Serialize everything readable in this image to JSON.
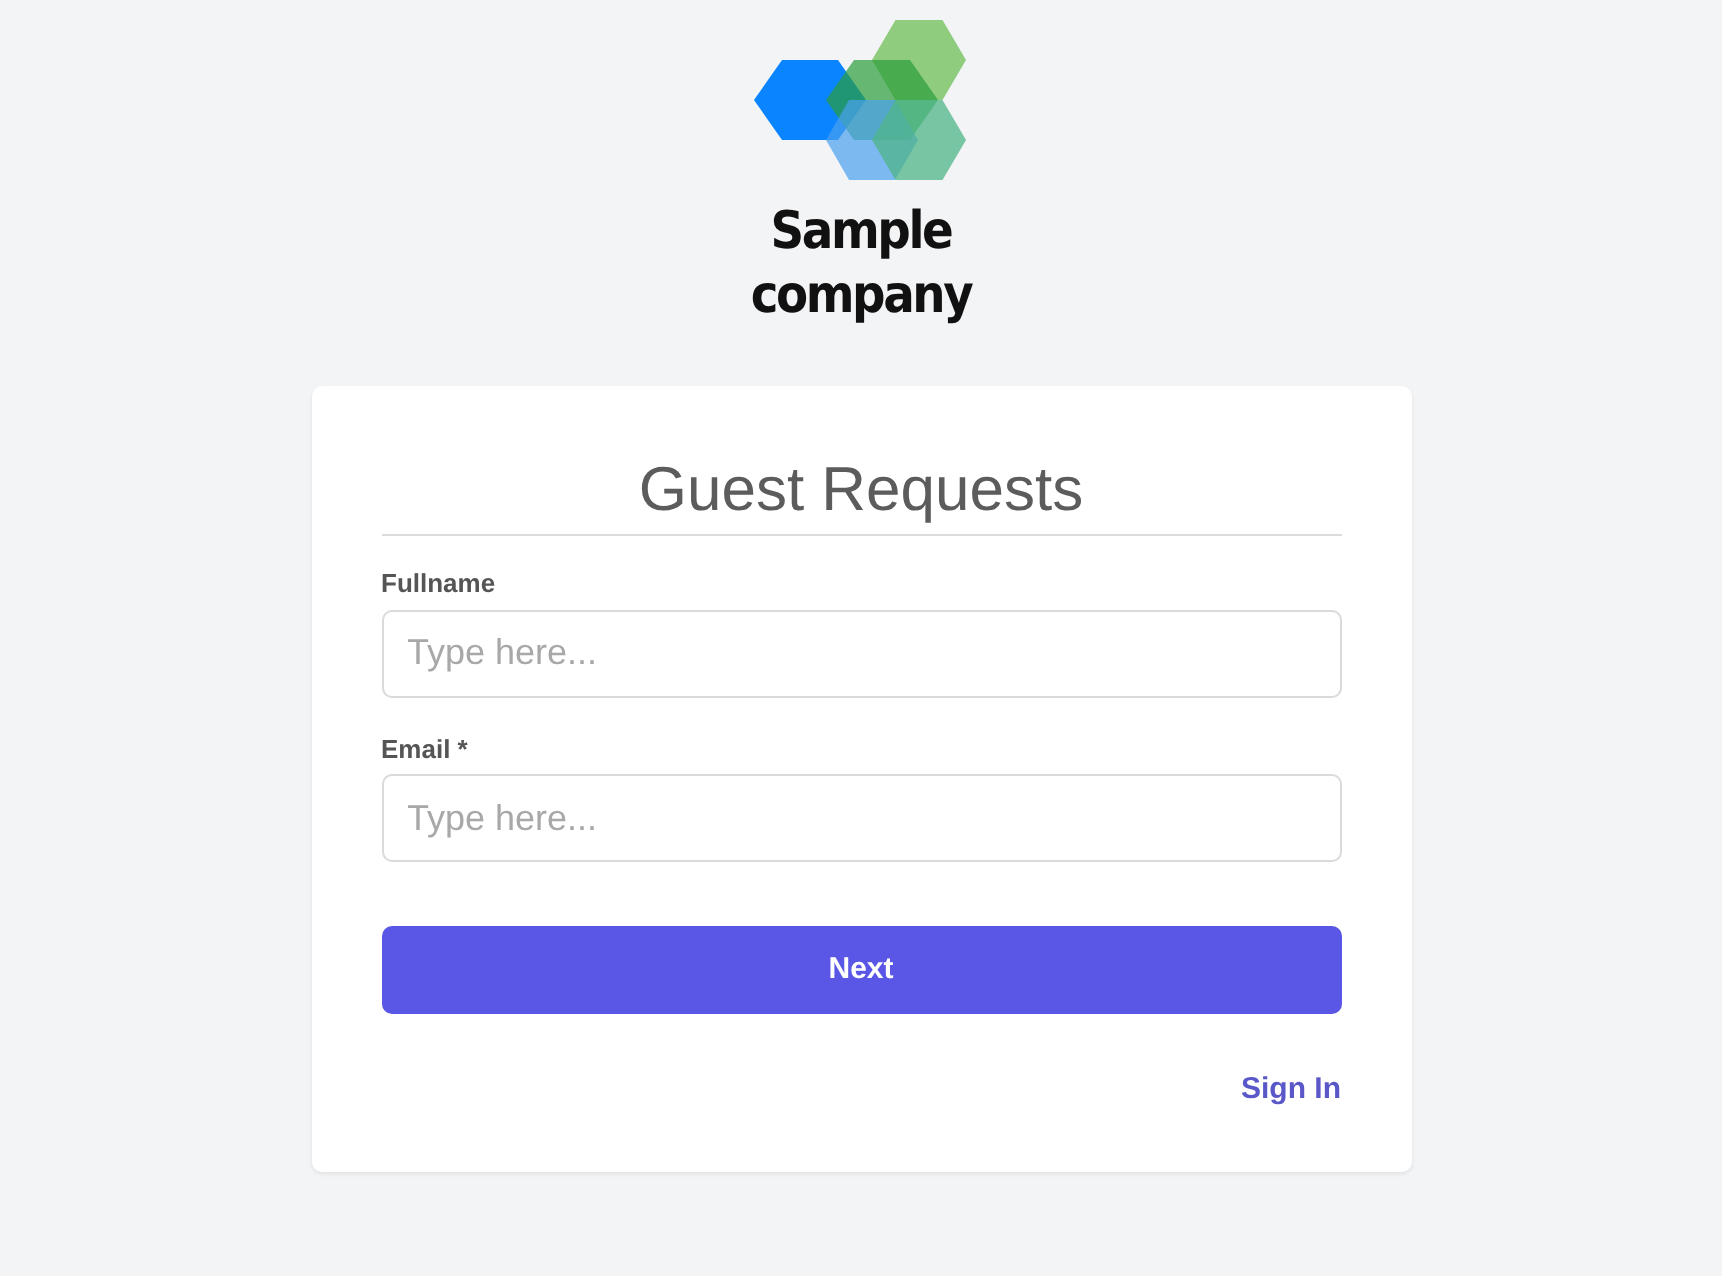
{
  "logo": {
    "company_name": "Sample company"
  },
  "form": {
    "title": "Guest Requests",
    "fields": [
      {
        "label": "Fullname",
        "placeholder": "Type here..."
      },
      {
        "label": "Email *",
        "placeholder": "Type here..."
      }
    ],
    "submit_button": "Next",
    "sign_in_link": "Sign In"
  }
}
